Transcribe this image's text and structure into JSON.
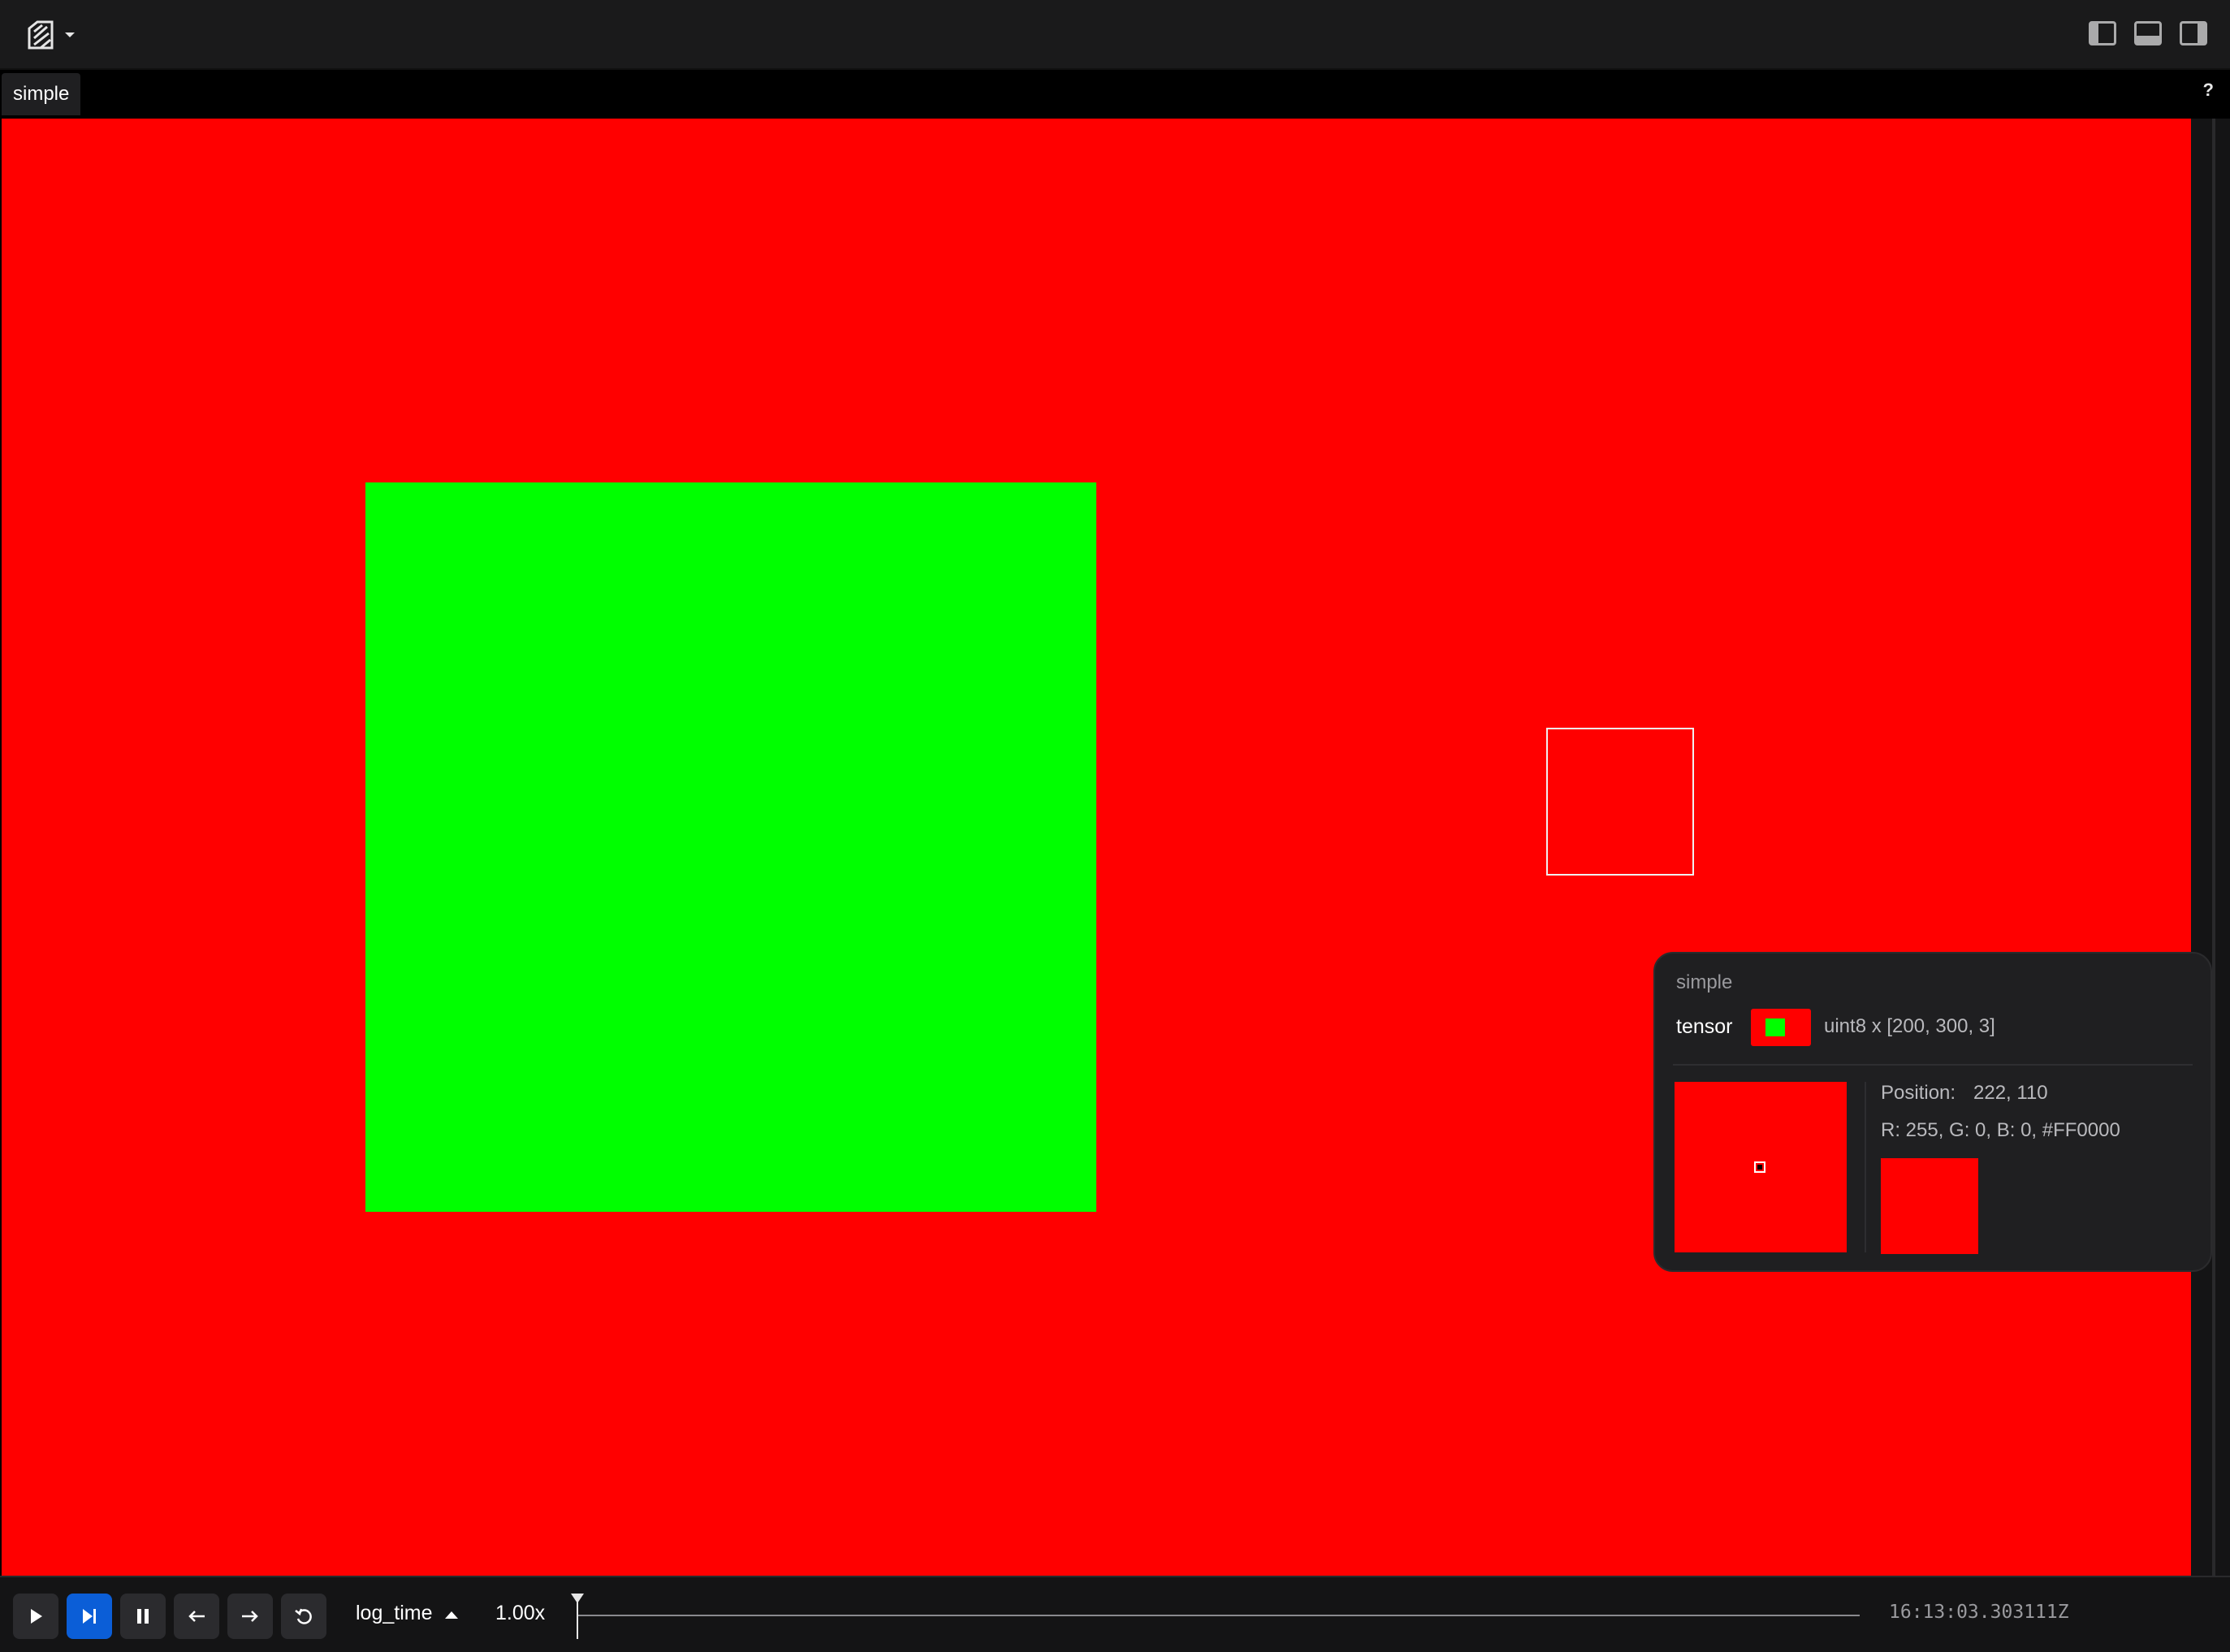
{
  "app": {
    "logo_icon": "rerun-logo-icon",
    "menu_caret_icon": "caret-down-icon",
    "panel_toggles": [
      "left-panel-toggle-icon",
      "bottom-panel-toggle-icon",
      "right-panel-toggle-icon"
    ]
  },
  "tabs": [
    {
      "label": "simple"
    }
  ],
  "help_label": "?",
  "viewport": {
    "background_color": "#FF0000",
    "square_color": "#00FF00"
  },
  "tooltip": {
    "entity_path": "simple",
    "component": "tensor",
    "dtype_shape": "uint8 x [200, 300, 3]",
    "position_label": "Position:",
    "position_value": "222, 110",
    "rgb_text": "R: 255, G: 0, B: 0, #FF0000",
    "swatch_color": "#FF0000"
  },
  "time_panel": {
    "buttons": [
      "play-icon",
      "step-to-end-icon",
      "pause-icon",
      "step-back-icon",
      "step-forward-icon",
      "loop-icon"
    ],
    "timeline_name": "log_time",
    "speed": "1.00x",
    "timestamp": "16:13:03.303111Z"
  }
}
